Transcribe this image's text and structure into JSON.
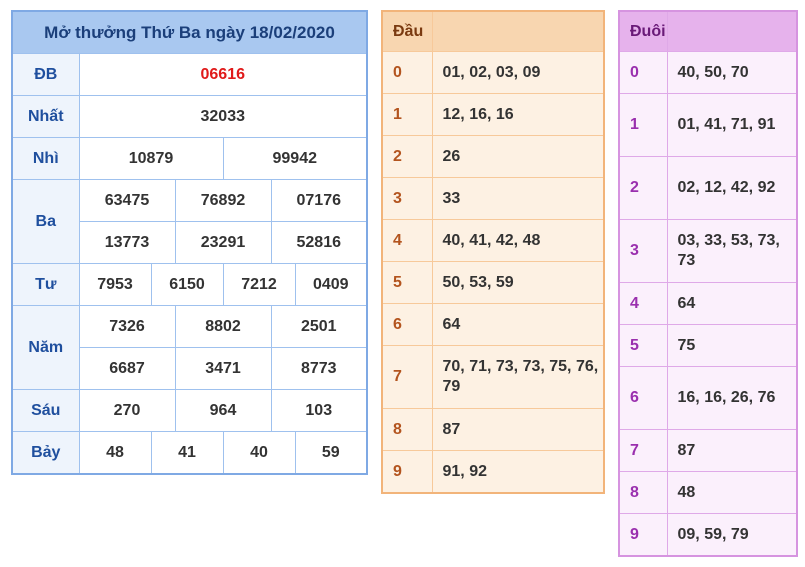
{
  "results": {
    "title": "Mở thưởng Thứ Ba ngày 18/02/2020",
    "db": {
      "label": "ĐB",
      "values": [
        "06616"
      ]
    },
    "nhat": {
      "label": "Nhất",
      "values": [
        "32033"
      ]
    },
    "nhi": {
      "label": "Nhì",
      "values": [
        "10879",
        "99942"
      ]
    },
    "ba": {
      "label": "Ba",
      "values": [
        "63475",
        "76892",
        "07176",
        "13773",
        "23291",
        "52816"
      ]
    },
    "tu": {
      "label": "Tư",
      "values": [
        "7953",
        "6150",
        "7212",
        "0409"
      ]
    },
    "nam": {
      "label": "Năm",
      "values": [
        "7326",
        "8802",
        "2501",
        "6687",
        "3471",
        "8773"
      ]
    },
    "sau": {
      "label": "Sáu",
      "values": [
        "270",
        "964",
        "103"
      ]
    },
    "bay": {
      "label": "Bảy",
      "values": [
        "48",
        "41",
        "40",
        "59"
      ]
    },
    "special_color": "#e01a1a"
  },
  "head_table": {
    "title": "Đầu",
    "rows": [
      {
        "key": "0",
        "value": "01, 02, 03, 09"
      },
      {
        "key": "1",
        "value": "12, 16, 16"
      },
      {
        "key": "2",
        "value": "26"
      },
      {
        "key": "3",
        "value": "33"
      },
      {
        "key": "4",
        "value": "40, 41, 42, 48"
      },
      {
        "key": "5",
        "value": "50, 53, 59"
      },
      {
        "key": "6",
        "value": "64"
      },
      {
        "key": "7",
        "value": "70, 71, 73, 73, 75, 76, 79"
      },
      {
        "key": "8",
        "value": "87"
      },
      {
        "key": "9",
        "value": "91, 92"
      }
    ]
  },
  "tail_table": {
    "title": "Đuôi",
    "rows": [
      {
        "key": "0",
        "value": "40, 50, 70"
      },
      {
        "key": "1",
        "value": "01, 41, 71, 91"
      },
      {
        "key": "2",
        "value": "02, 12, 42, 92"
      },
      {
        "key": "3",
        "value": "03, 33, 53, 73, 73"
      },
      {
        "key": "4",
        "value": "64"
      },
      {
        "key": "5",
        "value": "75"
      },
      {
        "key": "6",
        "value": "16, 16, 26, 76"
      },
      {
        "key": "7",
        "value": "87"
      },
      {
        "key": "8",
        "value": "48"
      },
      {
        "key": "9",
        "value": "09, 59, 79"
      }
    ]
  }
}
